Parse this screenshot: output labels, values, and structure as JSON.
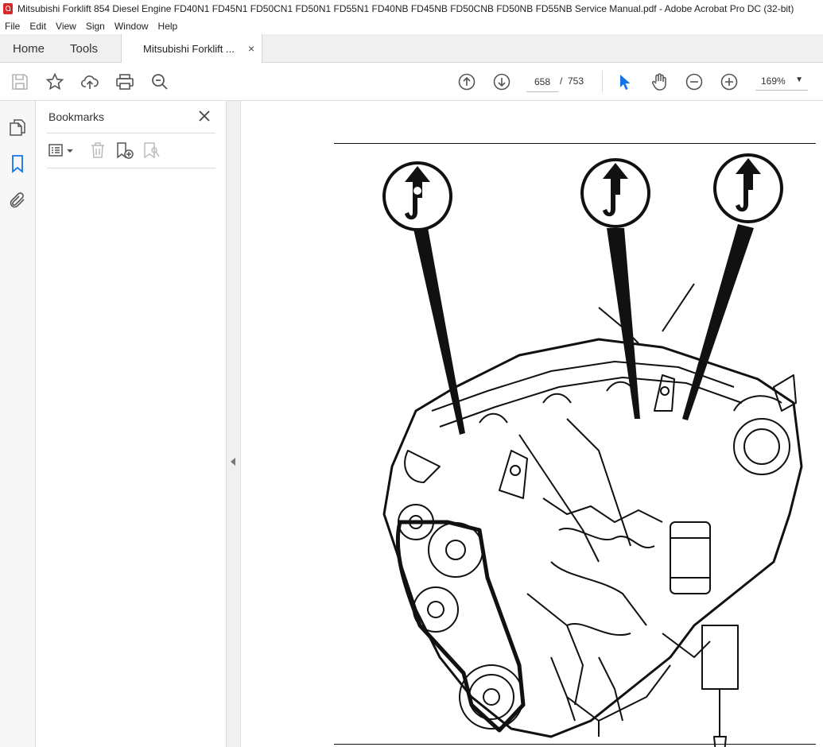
{
  "window": {
    "title": "Mitsubishi Forklift 854 Diesel Engine FD40N1 FD45N1 FD50CN1 FD50N1 FD55N1 FD40NB FD45NB FD50CNB FD50NB FD55NB Service Manual.pdf - Adobe Acrobat Pro DC (32-bit)",
    "app_icon": "acrobat-icon"
  },
  "menu": [
    "File",
    "Edit",
    "View",
    "Sign",
    "Window",
    "Help"
  ],
  "tabs": {
    "home": "Home",
    "tools": "Tools",
    "document": "Mitsubishi Forklift ...",
    "close": "×"
  },
  "toolbar": {
    "page_current": "658",
    "page_separator": "/",
    "page_total": "753",
    "zoom": "169%",
    "icons": [
      "save-icon",
      "bookmark-star-icon",
      "upload-icon",
      "print-icon",
      "zoom-search-icon",
      "page-up-icon",
      "page-down-icon",
      "select-arrow-icon",
      "hand-icon",
      "zoom-out-icon",
      "zoom-in-icon"
    ],
    "accent_color": "#1473e6"
  },
  "left_rail": {
    "icons": [
      "page-thumbnails-icon",
      "bookmarks-icon",
      "attachments-icon"
    ],
    "active": "bookmarks-icon"
  },
  "bookmarks_panel": {
    "title": "Bookmarks",
    "close": "×",
    "tools": [
      "options-menu-icon",
      "delete-icon",
      "add-bookmark-icon",
      "bookmark-properties-icon"
    ]
  },
  "document": {
    "content": "engine-lifting-points-illustration",
    "lift_markers": 3
  }
}
